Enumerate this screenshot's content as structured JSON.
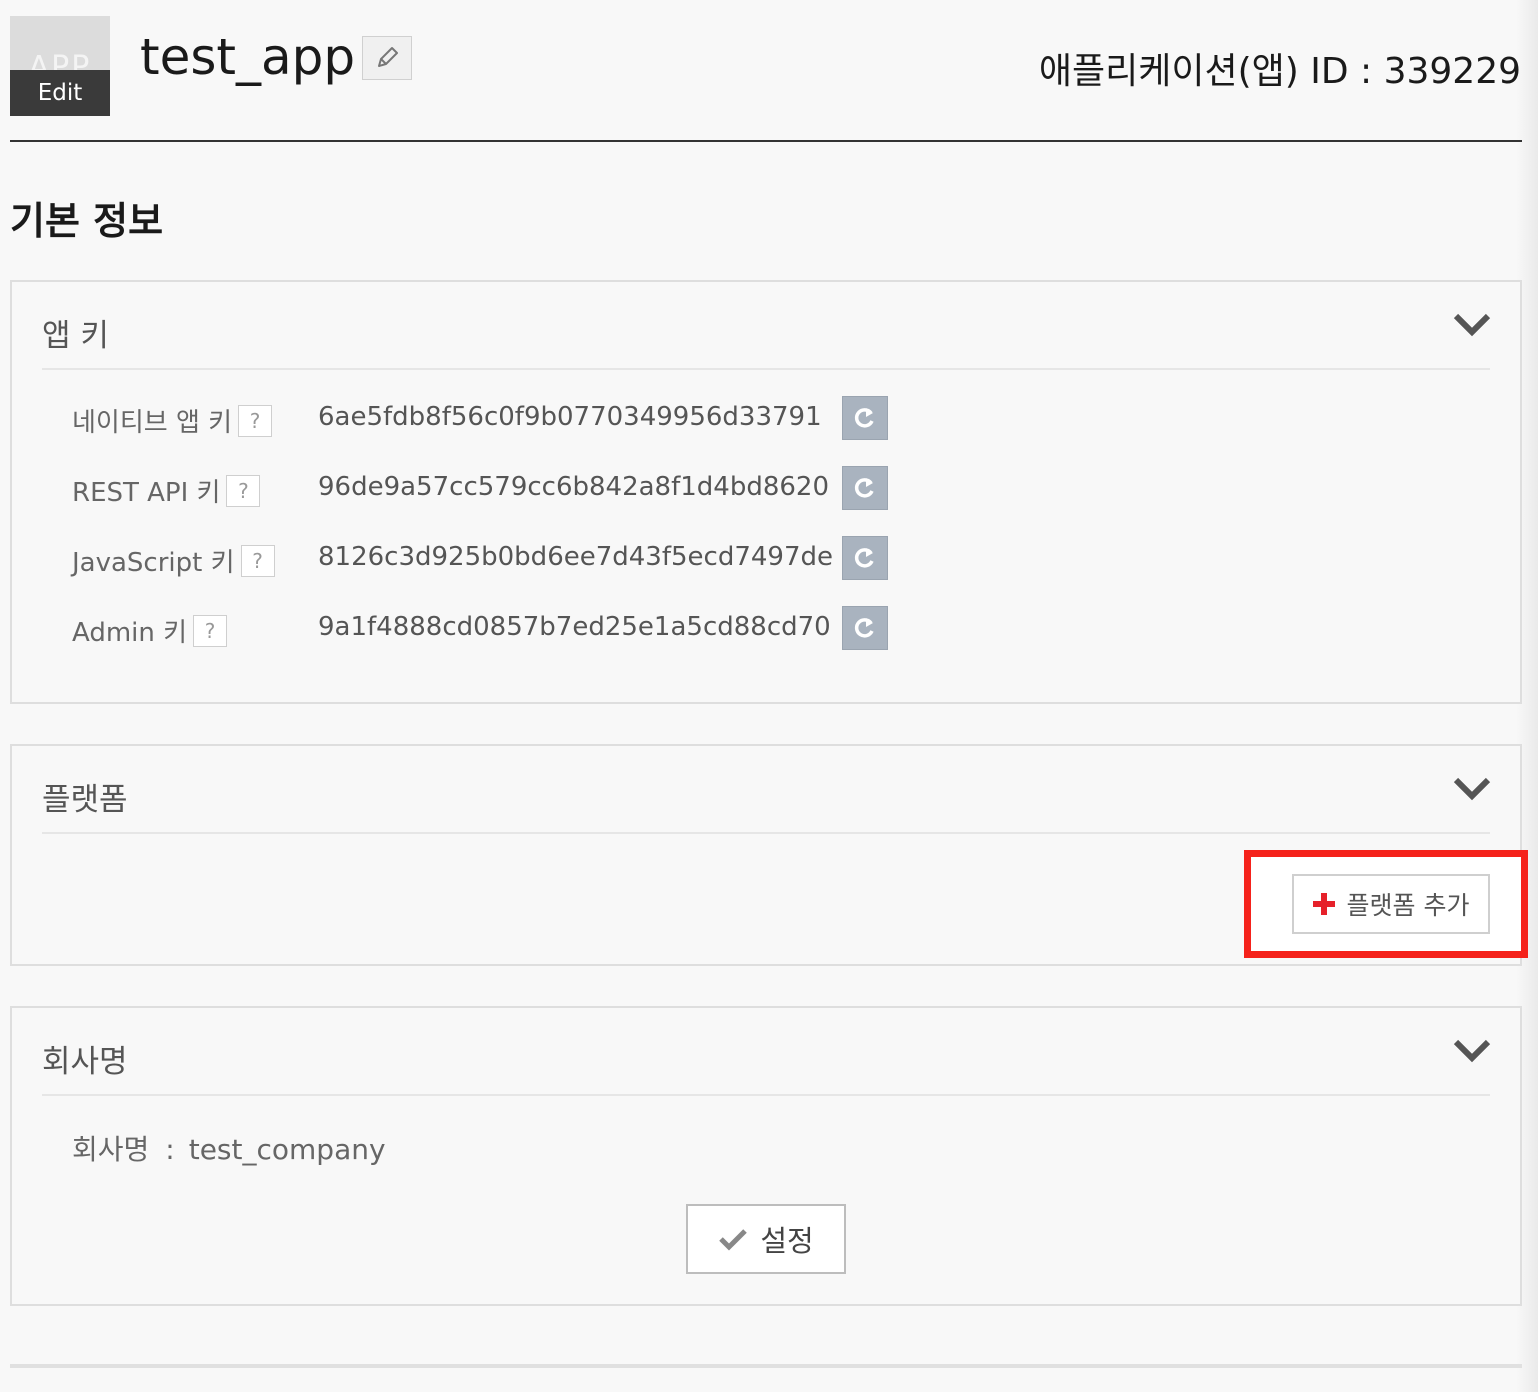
{
  "header": {
    "thumb_text": "APP",
    "thumb_edit_label": "Edit",
    "app_name": "test_app",
    "app_id_label": "애플리케이션(앱) ID : 339229"
  },
  "section_title": "기본 정보",
  "app_keys_panel": {
    "title": "앱 키",
    "keys": [
      {
        "label": "네이티브 앱 키",
        "help": "?",
        "value": "6ae5fdb8f56c0f9b0770349956d33791"
      },
      {
        "label": "REST API 키",
        "help": "?",
        "value": "96de9a57cc579cc6b842a8f1d4bd8620"
      },
      {
        "label": "JavaScript 키",
        "help": "?",
        "value": "8126c3d925b0bd6ee7d43f5ecd7497de"
      },
      {
        "label": "Admin 키",
        "help": "?",
        "value": "9a1f4888cd0857b7ed25e1a5cd88cd70"
      }
    ]
  },
  "platform_panel": {
    "title": "플랫폼",
    "add_button_label": "플랫폼 추가"
  },
  "company_panel": {
    "title": "회사명",
    "field_label": "회사명",
    "separator": ":",
    "field_value": "test_company",
    "settings_button_label": "설정"
  },
  "colors": {
    "accent_red": "#f5221b",
    "refresh_button": "#a9b3bf",
    "plus_icon": "#e6212a"
  }
}
